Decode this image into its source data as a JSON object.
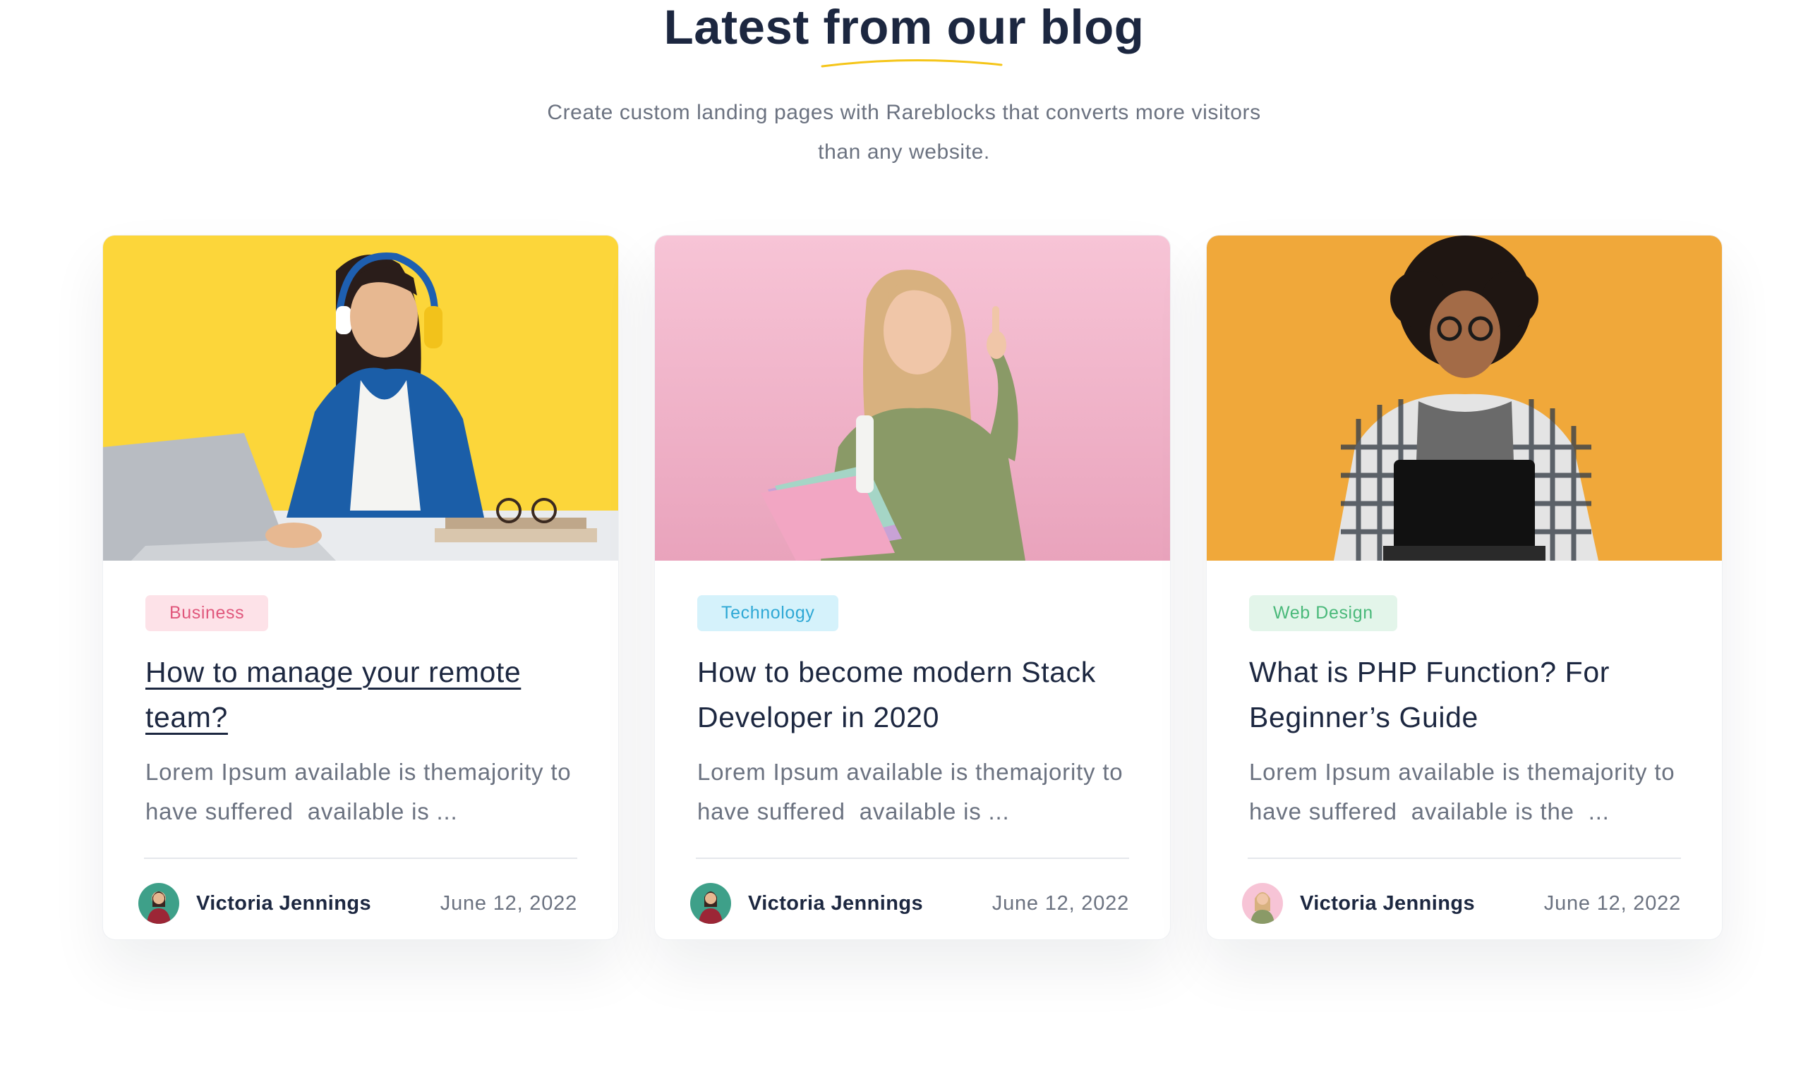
{
  "header": {
    "title": "Latest from our blog",
    "subtitle": "Create custom landing pages with Rareblocks that converts more visitors than any website.",
    "accent_color": "#f5c518"
  },
  "posts": [
    {
      "category": "Business",
      "title": "How to manage your remote team?",
      "excerpt": "Lorem Ipsum available is themajority to have suffered  available is ...",
      "author": "Victoria Jennings",
      "date": "June 12, 2022",
      "image": "woman-with-headphones-at-laptop",
      "background": "#fdd835",
      "avatar": "author-avatar"
    },
    {
      "category": "Technology",
      "title": "How to become modern Stack Developer in 2020",
      "excerpt": "Lorem Ipsum available is themajority to have suffered  available is ...",
      "author": "Victoria Jennings",
      "date": "June 12, 2022",
      "image": "woman-holding-notebooks-pointing-up",
      "background": "#f5b8cf",
      "avatar": "author-avatar"
    },
    {
      "category": "Web Design",
      "title": "What is PHP Function? For Beginner’s Guide",
      "excerpt": "Lorem Ipsum available is themajority to have suffered  available is the  ...",
      "author": "Victoria Jennings",
      "date": "June 12, 2022",
      "image": "man-holding-laptop",
      "background": "#f2a93b",
      "avatar": "author-avatar"
    }
  ]
}
